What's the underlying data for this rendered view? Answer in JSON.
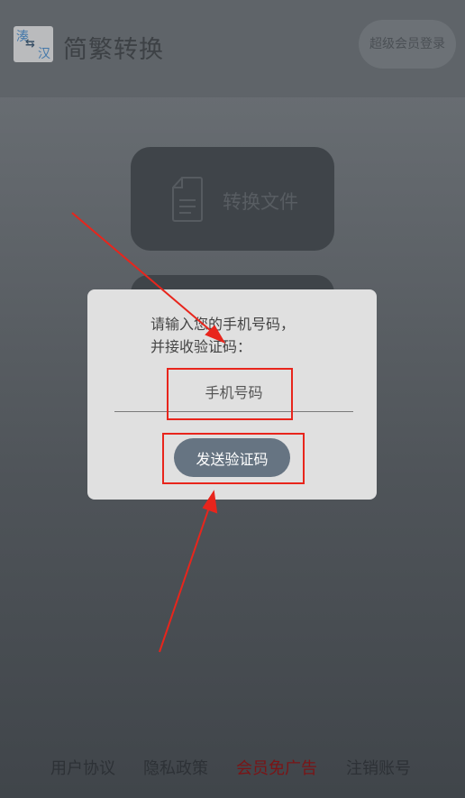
{
  "appbar": {
    "logo": {
      "top_char": "湊",
      "bottom_char": "汉",
      "swap_glyph": "⇆"
    },
    "title": "简繁转换",
    "vip_login": "超级会员登录"
  },
  "cards": {
    "convert_file": "转换文件"
  },
  "dialog": {
    "prompt_line1": "请输入您的手机号码，",
    "prompt_line2": "并接收验证码：",
    "phone_placeholder": "手机号码",
    "send_button": "发送验证码"
  },
  "footer": {
    "user_agreement": "用户协议",
    "privacy_policy": "隐私政策",
    "vip_no_ads": "会员免广告",
    "cancel_account": "注销账号"
  },
  "colors": {
    "annotation_red": "#e8251c",
    "button_bg": "#667482",
    "vip_link": "#7a1416"
  }
}
